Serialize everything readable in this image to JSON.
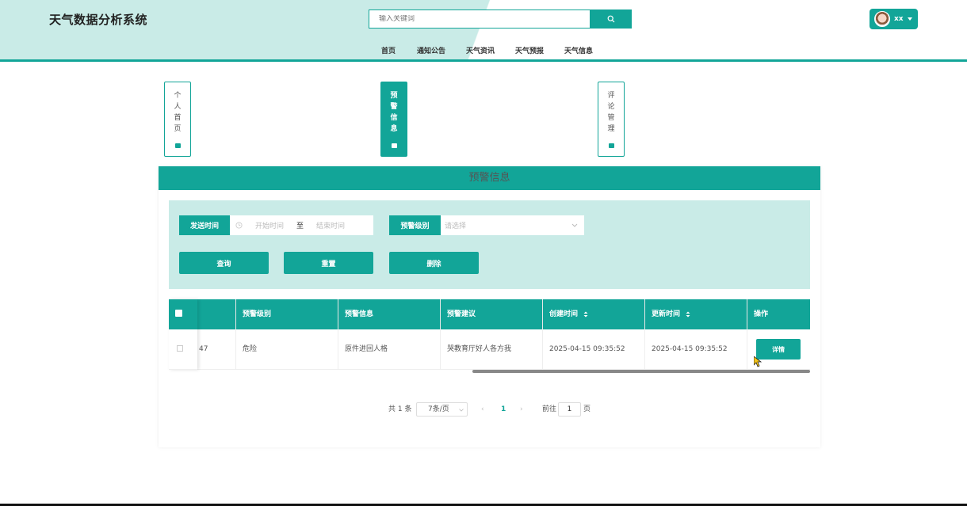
{
  "header": {
    "site_title": "天气数据分析系统",
    "search_placeholder": "输入关键词",
    "user_name": "xx"
  },
  "nav": {
    "items": [
      "首页",
      "通知公告",
      "天气资讯",
      "天气预报",
      "天气信息"
    ]
  },
  "side_menu": {
    "items": [
      {
        "label": "个人首页",
        "active": false
      },
      {
        "label": "预警信息",
        "active": true
      },
      {
        "label": "评论管理",
        "active": false
      }
    ]
  },
  "panel": {
    "title": "预警信息"
  },
  "filter": {
    "send_time_label": "发送时间",
    "start_placeholder": "开始时间",
    "range_sep": "至",
    "end_placeholder": "结束时间",
    "level_label": "预警级别",
    "level_placeholder": "请选择",
    "query_btn": "查询",
    "reset_btn": "重置",
    "delete_btn": "删除"
  },
  "table": {
    "columns": [
      "预警级别",
      "预警信息",
      "预警建议",
      "创建时间",
      "更新时间",
      "操作"
    ],
    "rows": [
      {
        "id": "47",
        "level": "危险",
        "info": "原件进回人格",
        "advice": "哭教育厅好人各方我",
        "created": "2025-04-15 09:35:52",
        "updated": "2025-04-15 09:35:52",
        "action": "详情"
      }
    ]
  },
  "pager": {
    "total": "共 1 条",
    "page_size": "7条/页",
    "current_page": "1",
    "goto_label": "前往",
    "goto_value": "1",
    "page_unit": "页"
  },
  "colors": {
    "accent": "#12a598",
    "light_accent": "#c9ebe7"
  }
}
